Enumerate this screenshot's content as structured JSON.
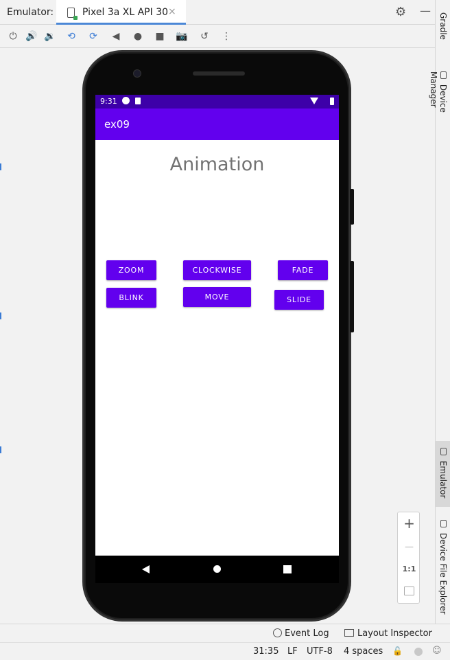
{
  "window": {
    "title": "Emulator:"
  },
  "tab": {
    "label": "Pixel 3a XL API 30",
    "close_glyph": "×"
  },
  "topbar_icons": {
    "settings": "⚙",
    "minimize": "—"
  },
  "toolbar": {
    "buttons": [
      {
        "name": "power-icon",
        "glyph": "⏻"
      },
      {
        "name": "volume-up-icon",
        "glyph": "🔊"
      },
      {
        "name": "volume-down-icon",
        "glyph": "🔉"
      },
      {
        "name": "rotate-left-icon",
        "glyph": "⟲"
      },
      {
        "name": "rotate-right-icon",
        "glyph": "⟳"
      },
      {
        "name": "back-icon",
        "glyph": "◀"
      },
      {
        "name": "home-icon",
        "glyph": "●"
      },
      {
        "name": "overview-icon",
        "glyph": "■"
      },
      {
        "name": "camera-icon",
        "glyph": "📷"
      },
      {
        "name": "snapshot-icon",
        "glyph": "↺"
      },
      {
        "name": "more-icon",
        "glyph": "⋮"
      }
    ]
  },
  "right_strip": {
    "tabs": [
      {
        "label": "Gradle"
      },
      {
        "label": "Device Manager"
      },
      {
        "label": "Emulator"
      },
      {
        "label": "Device File Explorer"
      }
    ]
  },
  "device": {
    "status_time": "9:31",
    "app_title": "ex09",
    "heading": "Animation",
    "buttons": {
      "zoom": "ZOOM",
      "clockwise": "CLOCKWISE",
      "fade": "FADE",
      "blink": "BLINK",
      "move": "MOVE",
      "slide": "SLIDE"
    }
  },
  "zoom_panel": {
    "zoom_in": "+",
    "zoom_out": "—",
    "actual_size": "1:1"
  },
  "bottom_bar": {
    "event_log": "Event Log",
    "layout_inspector": "Layout Inspector"
  },
  "status_bar": {
    "position": "31:35",
    "line_ending": "LF",
    "encoding": "UTF-8",
    "indent": "4 spaces"
  },
  "colors": {
    "primary": "#6200ee",
    "status_bar": "#3d00a8",
    "tab_underline": "#4b87d6"
  }
}
